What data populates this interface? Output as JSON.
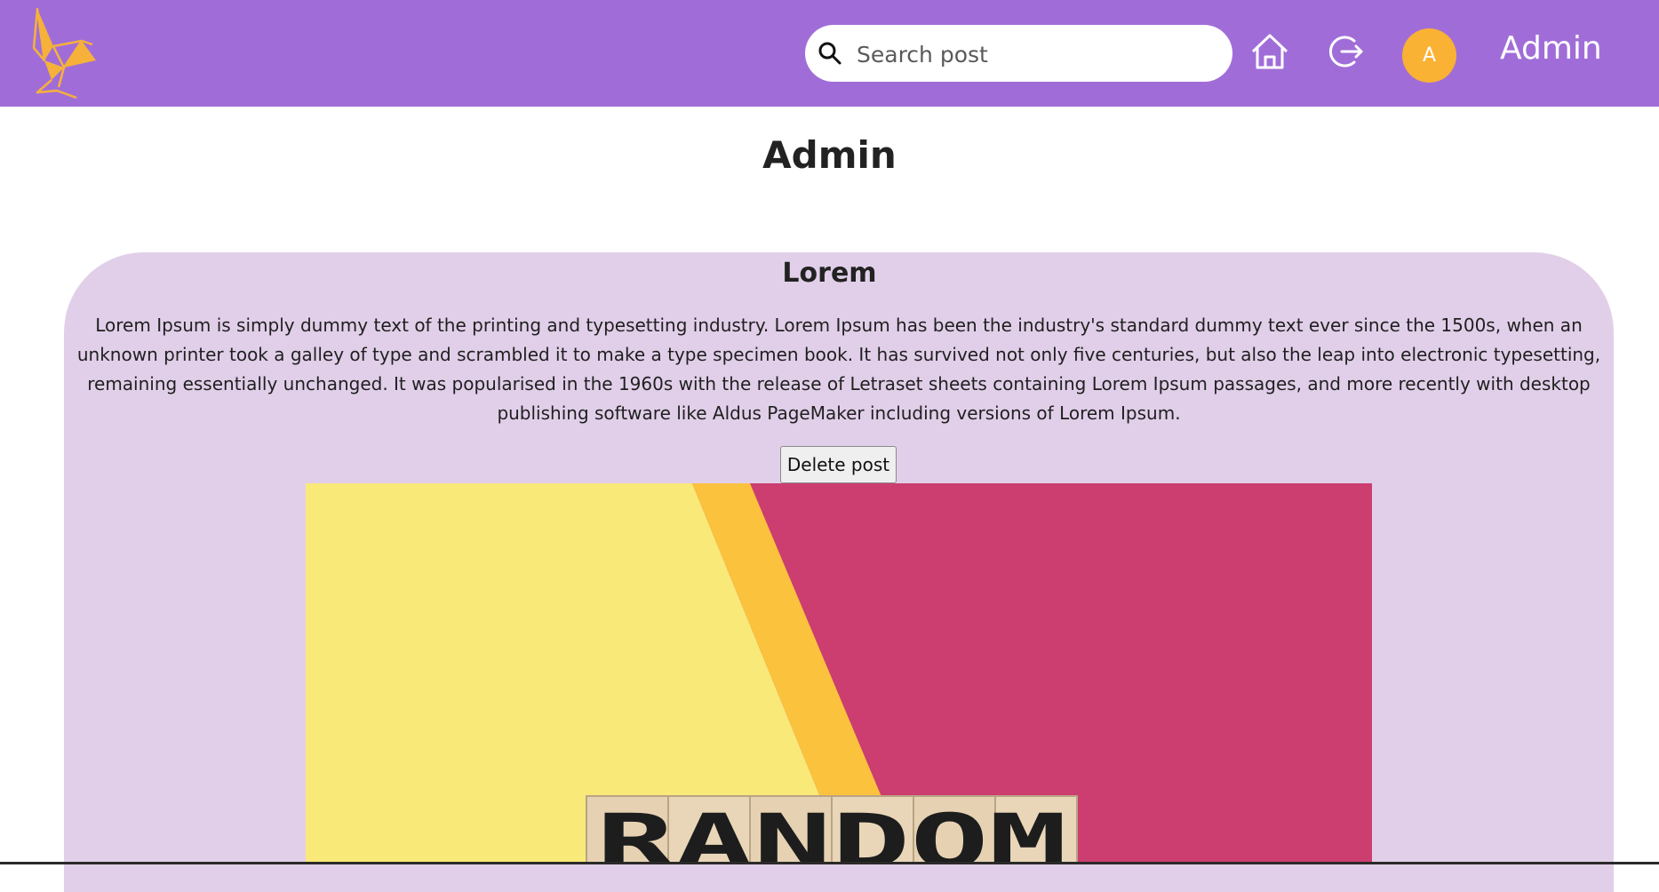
{
  "header": {
    "logo_icon": "origami-bird-icon",
    "search": {
      "placeholder": "Search post",
      "icon": "search-icon"
    },
    "home_icon": "home-icon",
    "logout_icon": "logout-icon",
    "avatar_letter": "A",
    "username": "Admin"
  },
  "page": {
    "title": "Admin"
  },
  "post": {
    "title": "Lorem",
    "body": "Lorem Ipsum is simply dummy text of the printing and typesetting industry. Lorem Ipsum has been the industry's standard dummy text ever since the 1500s, when an unknown printer took a galley of type and scrambled it to make a type specimen book. It has survived not only five centuries, but also the leap into electronic typesetting, remaining essentially unchanged. It was popularised in the 1960s with the release of Letraset sheets containing Lorem Ipsum passages, and more recently with desktop publishing software like Aldus PageMaker including versions of Lorem Ipsum.",
    "delete_label": "Delete post",
    "image_word": "RANDOM"
  },
  "colors": {
    "navbar": "#a06dd8",
    "accent": "#f9b233",
    "card": "#e1cfe9"
  }
}
